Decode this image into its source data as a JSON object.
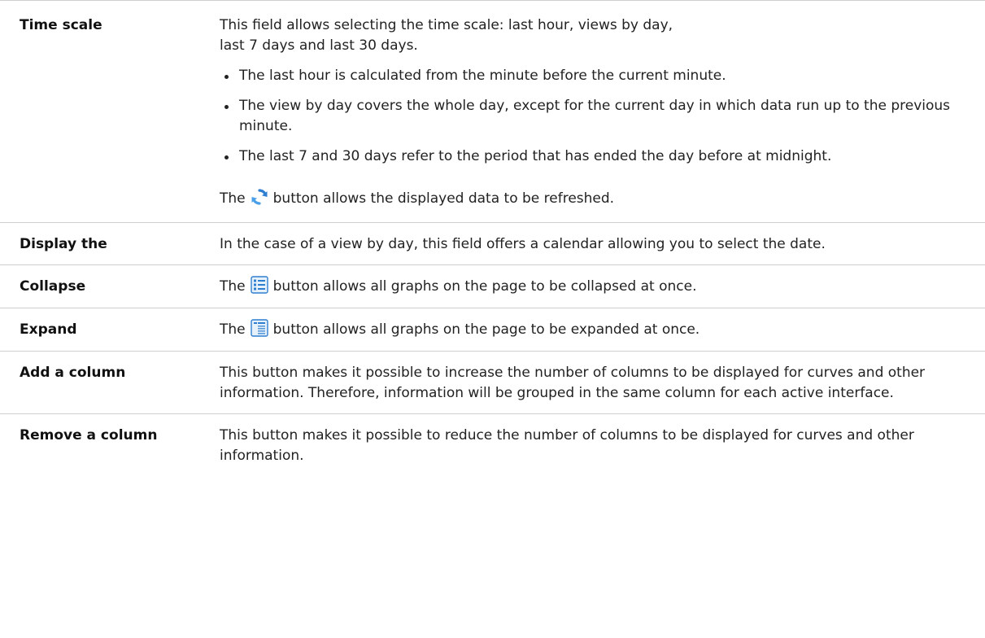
{
  "rows": [
    {
      "term": "Time scale",
      "desc_intro": "This field allows selecting the time scale: last hour, views by day,",
      "desc_intro2": "last 7 days and last 30 days.",
      "bullets": [
        "The last hour is calculated from the minute before the current minute.",
        "The view by day covers the whole day, except for the current day in which data run up to the previous minute.",
        "The last 7 and 30 days refer to the period that has ended the day before at midnight."
      ],
      "refresh_before": "The",
      "refresh_after": "button allows the displayed data to be refreshed.",
      "refresh_icon": "refresh-icon"
    },
    {
      "term": "Display the",
      "desc": "In the case of a view by day, this field offers a calendar allowing you to select the date."
    },
    {
      "term": "Collapse",
      "desc_before": "The",
      "desc_after": "button allows all graphs on the page to be collapsed at once.",
      "icon": "collapse-all-icon"
    },
    {
      "term": "Expand",
      "desc_before": "The",
      "desc_after": "button allows all graphs on the page to be expanded at once.",
      "icon": "expand-all-icon"
    },
    {
      "term": "Add a column",
      "desc": "This button makes it possible to increase the number of columns to be displayed for curves and other information. Therefore, information will be grouped in the same column for each active interface."
    },
    {
      "term": "Remove a column",
      "desc": "This button makes it possible to reduce the number of columns to be displayed for curves and other information."
    }
  ],
  "colors": {
    "border": "#cfcfcf",
    "icon_blue": "#2f7fd0"
  }
}
